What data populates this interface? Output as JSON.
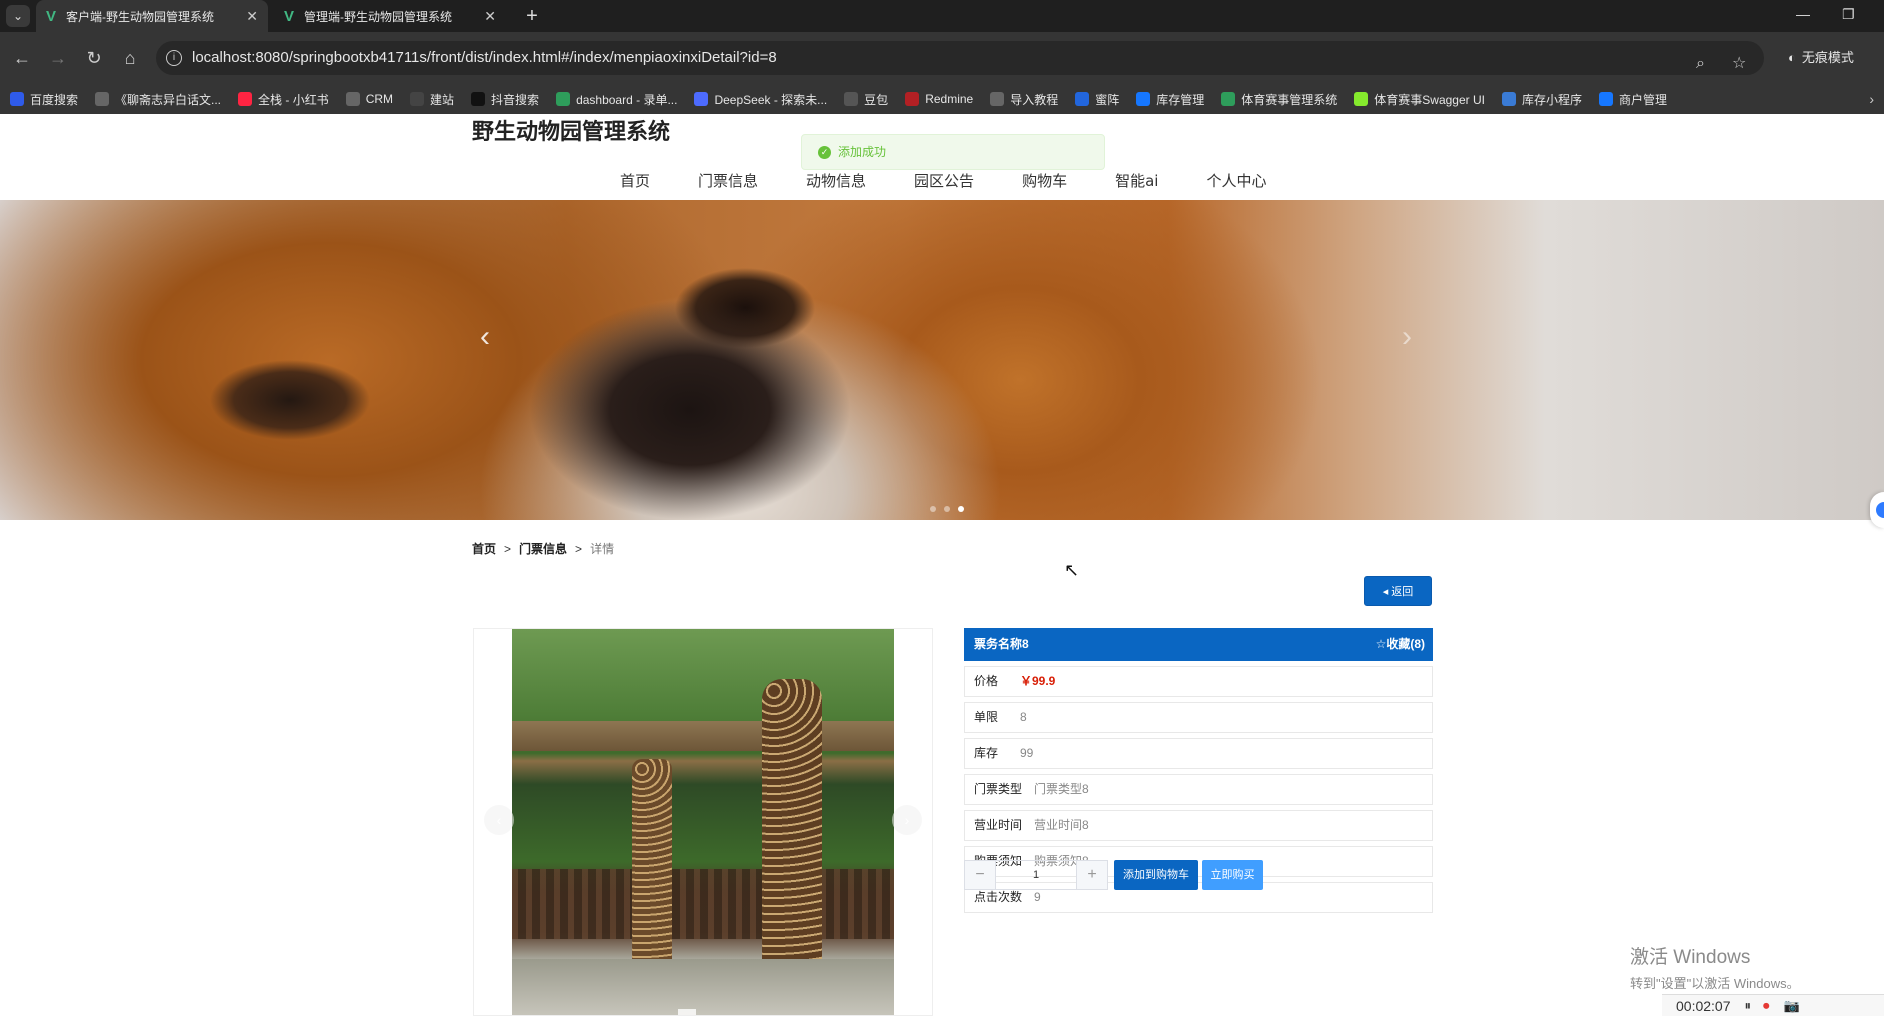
{
  "browser": {
    "tabs": [
      {
        "title": "客户端-野生动物园管理系统",
        "active": true
      },
      {
        "title": "管理端-野生动物园管理系统",
        "active": false
      }
    ],
    "url": "localhost:8080/springbootxb41711s/front/dist/index.html#/index/menpiaoxinxiDetail?id=8",
    "incognito_label": "无痕模式",
    "bookmarks": [
      {
        "label": "百度搜索",
        "icon": "paw-icon",
        "color": "#2f5bea"
      },
      {
        "label": "《聊斋志异白话文...",
        "icon": "globe-icon",
        "color": "#666666"
      },
      {
        "label": "全栈 - 小红书",
        "icon": "redbook-icon",
        "color": "#ff2442"
      },
      {
        "label": "CRM",
        "icon": "globe-icon",
        "color": "#666666"
      },
      {
        "label": "建站",
        "icon": "site-icon",
        "color": "#444444"
      },
      {
        "label": "抖音搜索",
        "icon": "tiktok-icon",
        "color": "#111111"
      },
      {
        "label": "dashboard - 录单...",
        "icon": "leaf-icon",
        "color": "#2e9d5b"
      },
      {
        "label": "DeepSeek - 探索未...",
        "icon": "whale-icon",
        "color": "#4d6bfe"
      },
      {
        "label": "豆包",
        "icon": "doubao-icon",
        "color": "#555555"
      },
      {
        "label": "Redmine",
        "icon": "redmine-icon",
        "color": "#b32024"
      },
      {
        "label": "导入教程",
        "icon": "globe-icon",
        "color": "#666666"
      },
      {
        "label": "蜜阵",
        "icon": "shield-icon",
        "color": "#2266dd"
      },
      {
        "label": "库存管理",
        "icon": "app-icon",
        "color": "#1677ff"
      },
      {
        "label": "体育赛事管理系统",
        "icon": "leaf-icon",
        "color": "#2e9d5b"
      },
      {
        "label": "体育赛事Swagger UI",
        "icon": "swagger-icon",
        "color": "#85ea2d"
      },
      {
        "label": "库存小程序",
        "icon": "triangle-icon",
        "color": "#3a7bd5"
      },
      {
        "label": "商户管理",
        "icon": "app-icon",
        "color": "#1677ff"
      }
    ]
  },
  "site": {
    "title": "野生动物园管理系统",
    "toast": "添加成功",
    "nav": [
      "首页",
      "门票信息",
      "动物信息",
      "园区公告",
      "购物车",
      "智能ai",
      "个人中心"
    ]
  },
  "breadcrumb": {
    "home": "首页",
    "section": "门票信息",
    "current": "详情",
    "sep": ">"
  },
  "back_label": "返回",
  "detail": {
    "name": "票务名称8",
    "favorite": "收藏(8)",
    "rows": [
      {
        "label": "价格",
        "value": "￥99.9"
      },
      {
        "label": "单限",
        "value": "8"
      },
      {
        "label": "库存",
        "value": "99"
      },
      {
        "label": "门票类型",
        "value": "门票类型8"
      },
      {
        "label": "营业时间",
        "value": "营业时间8"
      },
      {
        "label": "购票须知",
        "value": "购票须知8"
      },
      {
        "label": "点击次数",
        "value": "9"
      }
    ]
  },
  "purchase": {
    "quantity": "1",
    "minus": "−",
    "plus": "+",
    "add_to_cart": "添加到购物车",
    "buy_now": "立即购买"
  },
  "overlay": {
    "watermark_line1": "激活 Windows",
    "watermark_line2": "转到\"设置\"以激活 Windows。",
    "recorder_time": "00:02:07"
  },
  "colors": {
    "primary": "#0a66c2",
    "price": "#d81e06",
    "success": "#67c23a"
  }
}
